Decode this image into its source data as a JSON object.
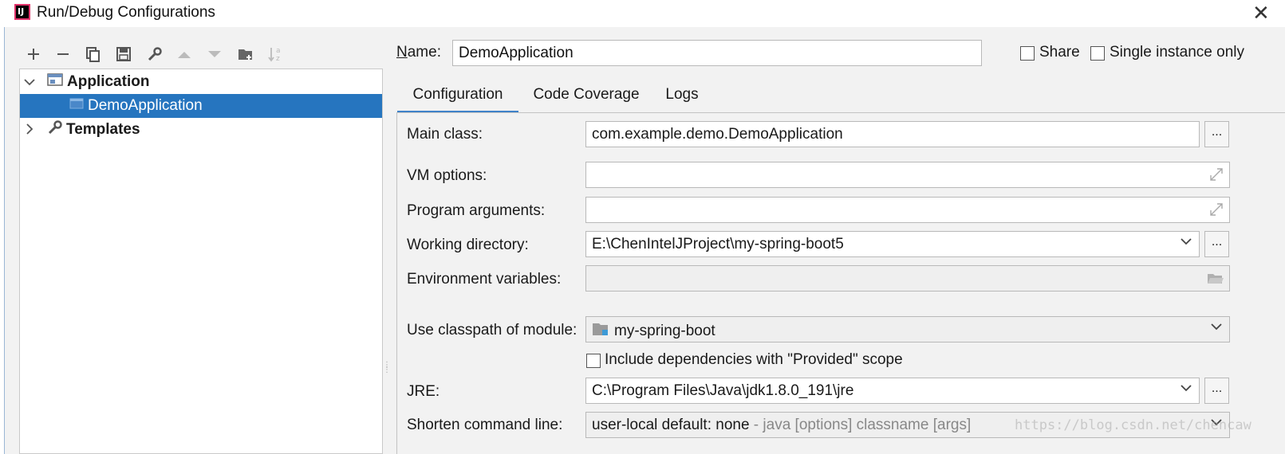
{
  "window": {
    "title": "Run/Debug Configurations",
    "logo": "IJ"
  },
  "toolbar": {
    "icons": [
      "plus-icon",
      "minus-icon",
      "copy-icon",
      "save-icon",
      "wrench-icon",
      "arrow-up-icon",
      "arrow-down-icon",
      "folder-add-icon",
      "sort-az-icon"
    ]
  },
  "tree": {
    "application": "Application",
    "demo": "DemoApplication",
    "templates": "Templates"
  },
  "name": {
    "label": "Name:",
    "value": "DemoApplication"
  },
  "share": {
    "label": "Share"
  },
  "single_instance": {
    "label": "Single instance only"
  },
  "tabs": [
    "Configuration",
    "Code Coverage",
    "Logs"
  ],
  "form": {
    "main_class": {
      "label": "Main class:",
      "value": "com.example.demo.DemoApplication"
    },
    "vm_options": {
      "label": "VM options:",
      "value": ""
    },
    "program_arguments": {
      "label": "Program arguments:",
      "value": ""
    },
    "working_directory": {
      "label": "Working directory:",
      "value": "E:\\ChenIntelJProject\\my-spring-boot5"
    },
    "environment_variables": {
      "label": "Environment variables:",
      "value": ""
    },
    "classpath_module": {
      "label": "Use classpath of module:",
      "value": "my-spring-boot"
    },
    "include_dependencies": {
      "label": "Include dependencies with \"Provided\" scope"
    },
    "jre": {
      "label": "JRE:",
      "value": "C:\\Program Files\\Java\\jdk1.8.0_191\\jre"
    },
    "shorten_command_line": {
      "label": "Shorten command line:",
      "value": "user-local default: none",
      "hint": " - java [options] classname [args]"
    }
  },
  "browse_label": "...",
  "watermark": "https://blog.csdn.net/chencaw"
}
